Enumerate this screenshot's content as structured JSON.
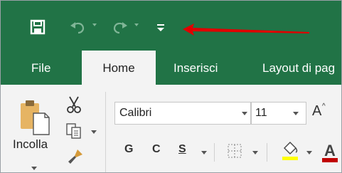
{
  "quick_access": {
    "save_icon": "save-icon",
    "undo_icon": "undo-icon",
    "redo_icon": "redo-icon",
    "customize_icon": "customize-qat-icon"
  },
  "tabs": [
    {
      "label": "File"
    },
    {
      "label": "Home"
    },
    {
      "label": "Inserisci"
    },
    {
      "label": "Layout di pag"
    }
  ],
  "clipboard": {
    "paste_label": "Incolla"
  },
  "font": {
    "name": "Calibri",
    "size": "11",
    "grow_label": "A",
    "bold": "G",
    "italic": "C",
    "underline": "S"
  },
  "colors": {
    "ribbon_green": "#217346",
    "highlight": "#ffff00",
    "font_color": "#c00000",
    "annotation": "#e00000"
  }
}
